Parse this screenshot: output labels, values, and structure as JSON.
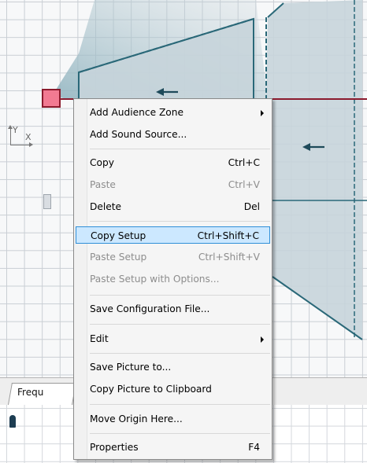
{
  "tab": {
    "label": "Frequ"
  },
  "context_menu": {
    "items": [
      {
        "label": "Add Audience Zone",
        "submenu": true
      },
      {
        "label": "Add Sound Source..."
      },
      {
        "label": "Copy",
        "shortcut": "Ctrl+C"
      },
      {
        "label": "Paste",
        "shortcut": "Ctrl+V",
        "disabled": true
      },
      {
        "label": "Delete",
        "shortcut": "Del"
      },
      {
        "label": "Copy Setup",
        "shortcut": "Ctrl+Shift+C",
        "highlighted": true
      },
      {
        "label": "Paste Setup",
        "shortcut": "Ctrl+Shift+V",
        "disabled": true
      },
      {
        "label": "Paste Setup with Options...",
        "disabled": true
      },
      {
        "label": "Save Configuration File..."
      },
      {
        "label": "Edit",
        "submenu": true
      },
      {
        "label": "Save Picture to..."
      },
      {
        "label": "Copy Picture to Clipboard"
      },
      {
        "label": "Move Origin Here..."
      },
      {
        "label": "Properties",
        "shortcut": "F4"
      }
    ]
  },
  "axis_widget": {
    "y": "Y",
    "x": "X"
  },
  "colors": {
    "zone_fill": "#c7d4da",
    "zone_stroke": "#2a6878",
    "selection_line": "#8b1a2d",
    "handle_fill": "#f27a92",
    "menu_highlight": "#cce8ff"
  }
}
